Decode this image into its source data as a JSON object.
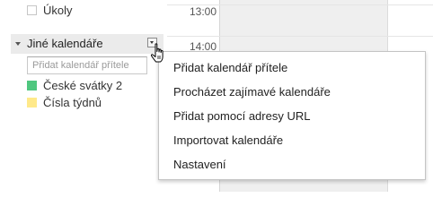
{
  "sidebar": {
    "tasks_label": "Úkoly",
    "other_calendars": {
      "title": "Jiné kalendáře",
      "add_placeholder": "Přidat kalendář přítele",
      "calendars": [
        {
          "label": "České svátky 2",
          "color": "#4fc77f"
        },
        {
          "label": "Čísla týdnů",
          "color": "#ffe98a"
        }
      ]
    }
  },
  "timegrid": {
    "hours": [
      "13:00",
      "14:00"
    ]
  },
  "menu": {
    "items": [
      "Přidat kalendář přítele",
      "Procházet zajímavé kalendáře",
      "Přidat pomocí adresy URL",
      "Importovat kalendáře",
      "Nastavení"
    ]
  }
}
